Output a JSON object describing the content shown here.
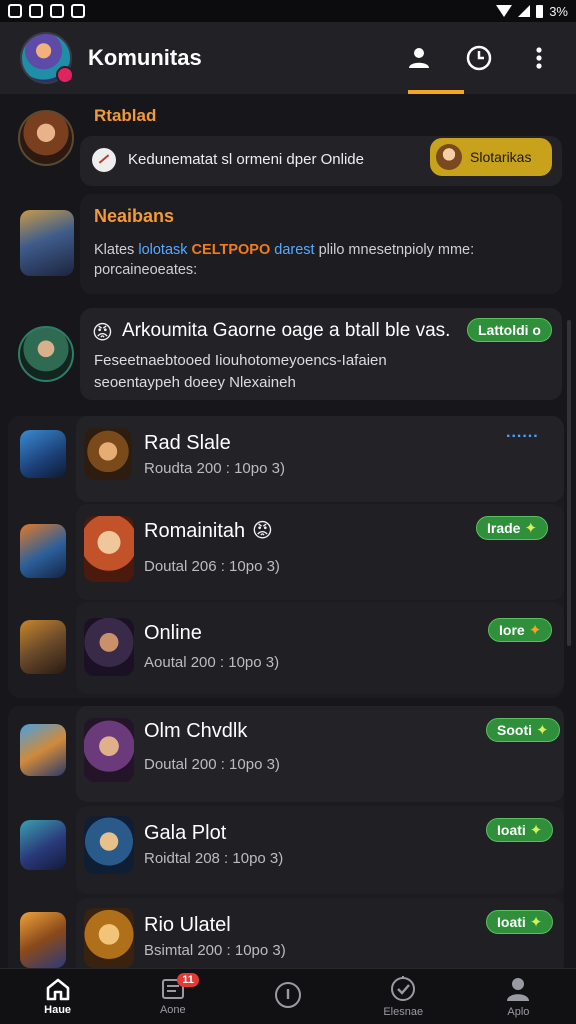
{
  "status_bar": {
    "battery": "3%"
  },
  "app_bar": {
    "title": "Komunitas"
  },
  "feed": {
    "item1": {
      "name": "Rtablad",
      "message": "Kedunematat sl ormeni dper Onlide",
      "chip": "Slotarikas"
    },
    "item2": {
      "name": "Neaibans",
      "text_pre": "Klates ",
      "link1": "lolotask",
      "link2": "CELTPOPO",
      "link3": "darest",
      "text_post": " plilo mnesetnpioly mme: porcaineoeates:"
    },
    "item3": {
      "emoji": "😡",
      "title": "Arkoumita Gaorne oage a btall ble vas.",
      "badge": "Lattoldi o",
      "line1": "Feseetnaebtooed Iiouhotomeyoencs-Iafaien",
      "line2": "seoentaypeh doeey Nlexaineh"
    }
  },
  "list_group1": [
    {
      "title": "Rad Slale",
      "subtitle": "Roudta 200 : 10po 3)",
      "extra": "......"
    },
    {
      "title": "Romainitah",
      "emoji": "😡",
      "subtitle": "Doutal 206 : 10po 3)",
      "badge": "Irade"
    },
    {
      "title": "Online",
      "subtitle": "Aoutal 200 : 10po 3)",
      "badge": "Iore"
    }
  ],
  "list_group2": [
    {
      "title": "Olm Chvdlk",
      "subtitle": "Doutal 200 : 10po 3)",
      "badge": "Sooti"
    },
    {
      "title": "Gala Plot",
      "subtitle": "Roidtal 208 : 10po 3)",
      "badge": "Ioati"
    },
    {
      "title": "Rio Ulatel",
      "subtitle": "Bsimtal 200 : 10po 3)",
      "badge": "Ioati"
    }
  ],
  "bottom_nav": [
    {
      "label": "Haue"
    },
    {
      "label": "Aone",
      "badge": "11"
    },
    {
      "label": ""
    },
    {
      "label": "Elesnae"
    },
    {
      "label": "Aplo"
    }
  ],
  "colors": {
    "accent": "#f4a623",
    "badge_green": "#2f8f3a",
    "link_blue": "#5aa9ff",
    "link_orange": "#f27b1b"
  }
}
